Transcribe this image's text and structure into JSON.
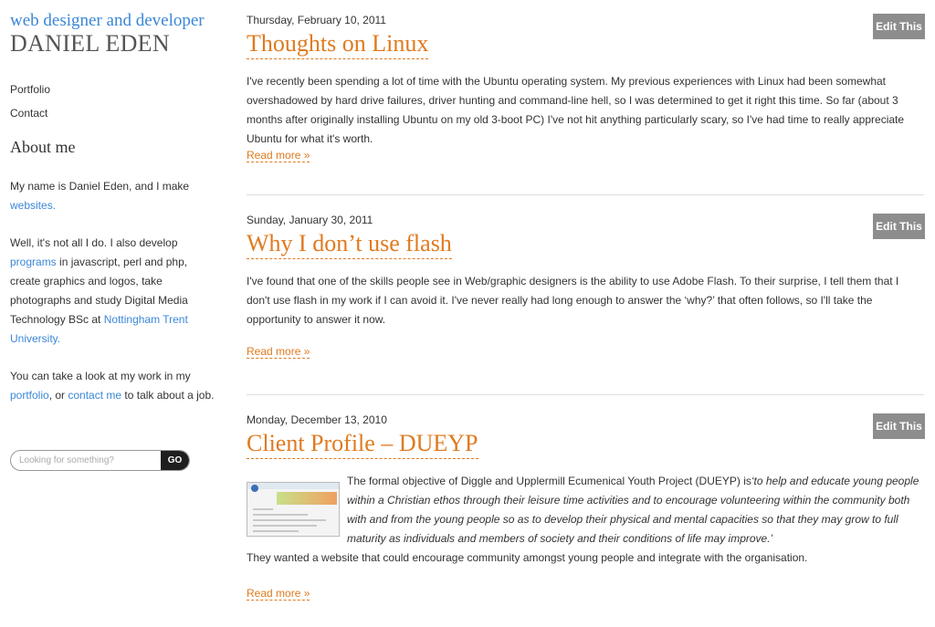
{
  "sidebar": {
    "tagline": "web designer and developer",
    "site_name": "DANIEL EDEN",
    "nav": [
      "Portfolio",
      "Contact"
    ],
    "about_heading": "About me",
    "about": {
      "p1_text": "My name is Daniel Eden, and I make ",
      "p1_link": "websites.",
      "p2_a": "Well, it's not all I do. I also develop ",
      "p2_link1": "programs",
      "p2_b": " in javascript, perl and php, create graphics and logos, take photographs and study Digital Media Technology BSc at ",
      "p2_link2": "Nottingham Trent University.",
      "p3_a": "You can take a look at my work in my ",
      "p3_link1": "portfolio",
      "p3_b": ", or ",
      "p3_link2": "contact me",
      "p3_c": " to talk about a job."
    },
    "search": {
      "placeholder": "Looking for something?",
      "button": "GO"
    }
  },
  "posts": [
    {
      "date": "Thursday, February 10, 2011",
      "title": "Thoughts on Linux",
      "body": "I've recently been spending a lot of time with the Ubuntu operating system. My previous experiences with Linux had been somewhat overshadowed by hard drive failures, driver hunting and command-line hell, so I was determined to get it right this time. So far (about 3 months after originally installing Ubuntu on my old 3-boot PC) I've not hit anything particularly scary, so I've had time to really appreciate Ubuntu for what it's worth.",
      "read_more": "Read more »",
      "edit": "Edit This"
    },
    {
      "date": "Sunday, January 30, 2011",
      "title": "Why I don’t use flash",
      "body": "I've found that one of the skills people see in Web/graphic designers is the ability to use Adobe Flash. To their surprise, I tell them that I don't use flash in my work if I can avoid it. I've never really had long enough to answer the ‘why?’ that often follows, so I'll take the opportunity to answer it now.",
      "read_more": "Read more »",
      "edit": "Edit This"
    },
    {
      "date": "Monday, December 13, 2010",
      "title": "Client Profile – DUEYP",
      "body_a": "The formal objective of Diggle and Upplermill Ecumenical Youth Project (DUEYP) is",
      "body_quote": "‘to help and educate young people within a Christian ethos through their leisure time activities and to encourage volunteering within the community both with and from the young people so as to develop their physical and mental capacities so that they may grow to full maturity as individuals and members of society and their conditions of life may improve.’",
      "body_b": "They wanted a website that could encourage community amongst young people and integrate with the organisation.",
      "read_more": "Read more »",
      "edit": "Edit This"
    }
  ]
}
